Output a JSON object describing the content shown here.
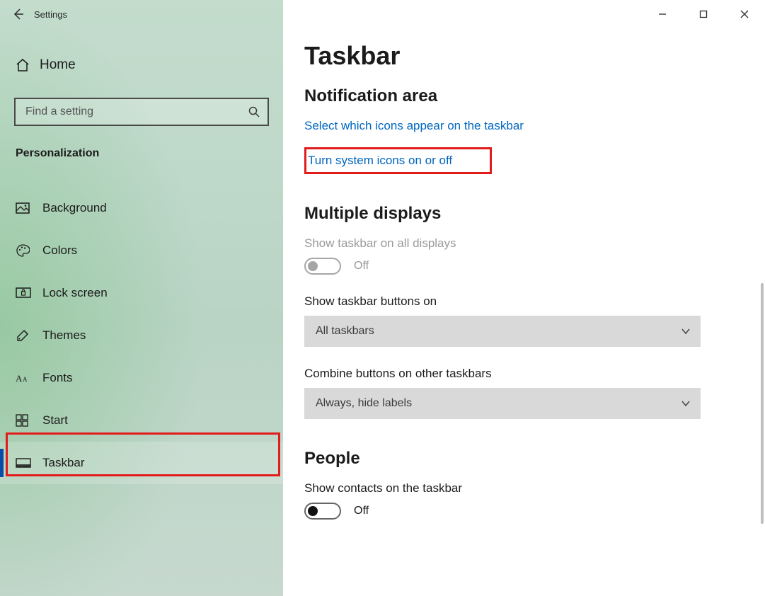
{
  "window": {
    "app_title": "Settings"
  },
  "sidebar": {
    "home_label": "Home",
    "search_placeholder": "Find a setting",
    "category_label": "Personalization",
    "items": [
      {
        "label": "Background"
      },
      {
        "label": "Colors"
      },
      {
        "label": "Lock screen"
      },
      {
        "label": "Themes"
      },
      {
        "label": "Fonts"
      },
      {
        "label": "Start"
      },
      {
        "label": "Taskbar"
      }
    ]
  },
  "page": {
    "title": "Taskbar",
    "notification_area": {
      "heading": "Notification area",
      "link_select_icons": "Select which icons appear on the taskbar",
      "link_system_icons": "Turn system icons on or off"
    },
    "multiple_displays": {
      "heading": "Multiple displays",
      "show_all_label": "Show taskbar on all displays",
      "show_all_state": "Off",
      "show_buttons_label": "Show taskbar buttons on",
      "show_buttons_value": "All taskbars",
      "combine_label": "Combine buttons on other taskbars",
      "combine_value": "Always, hide labels"
    },
    "people": {
      "heading": "People",
      "show_contacts_label": "Show contacts on the taskbar",
      "show_contacts_state": "Off"
    }
  }
}
